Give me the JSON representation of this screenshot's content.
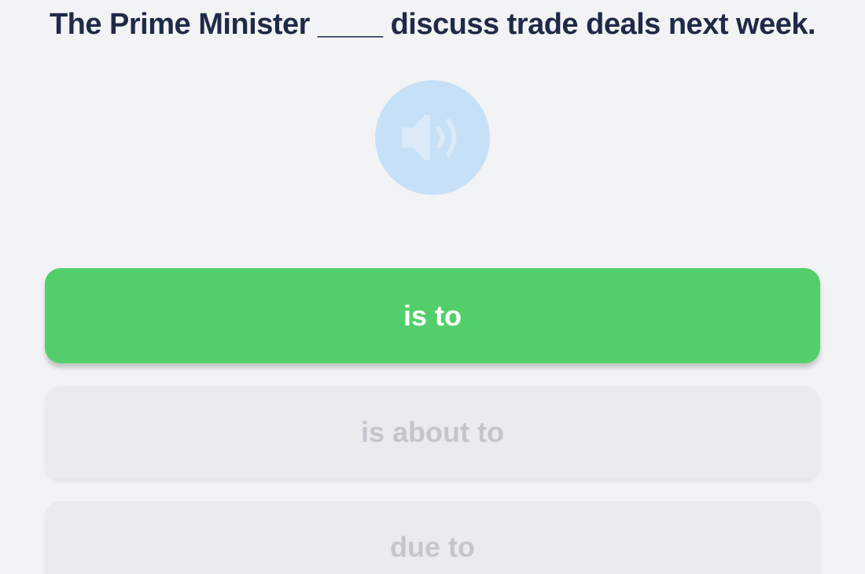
{
  "question": {
    "text": "The Prime Minister ____ discuss trade deals next week."
  },
  "audio": {
    "icon": "speaker-icon",
    "color": "#c6e0f8"
  },
  "options": [
    {
      "label": "is to",
      "state": "selected",
      "color": "#52cf6a"
    },
    {
      "label": "is about to",
      "state": "disabled"
    },
    {
      "label": "due to",
      "state": "disabled"
    }
  ]
}
